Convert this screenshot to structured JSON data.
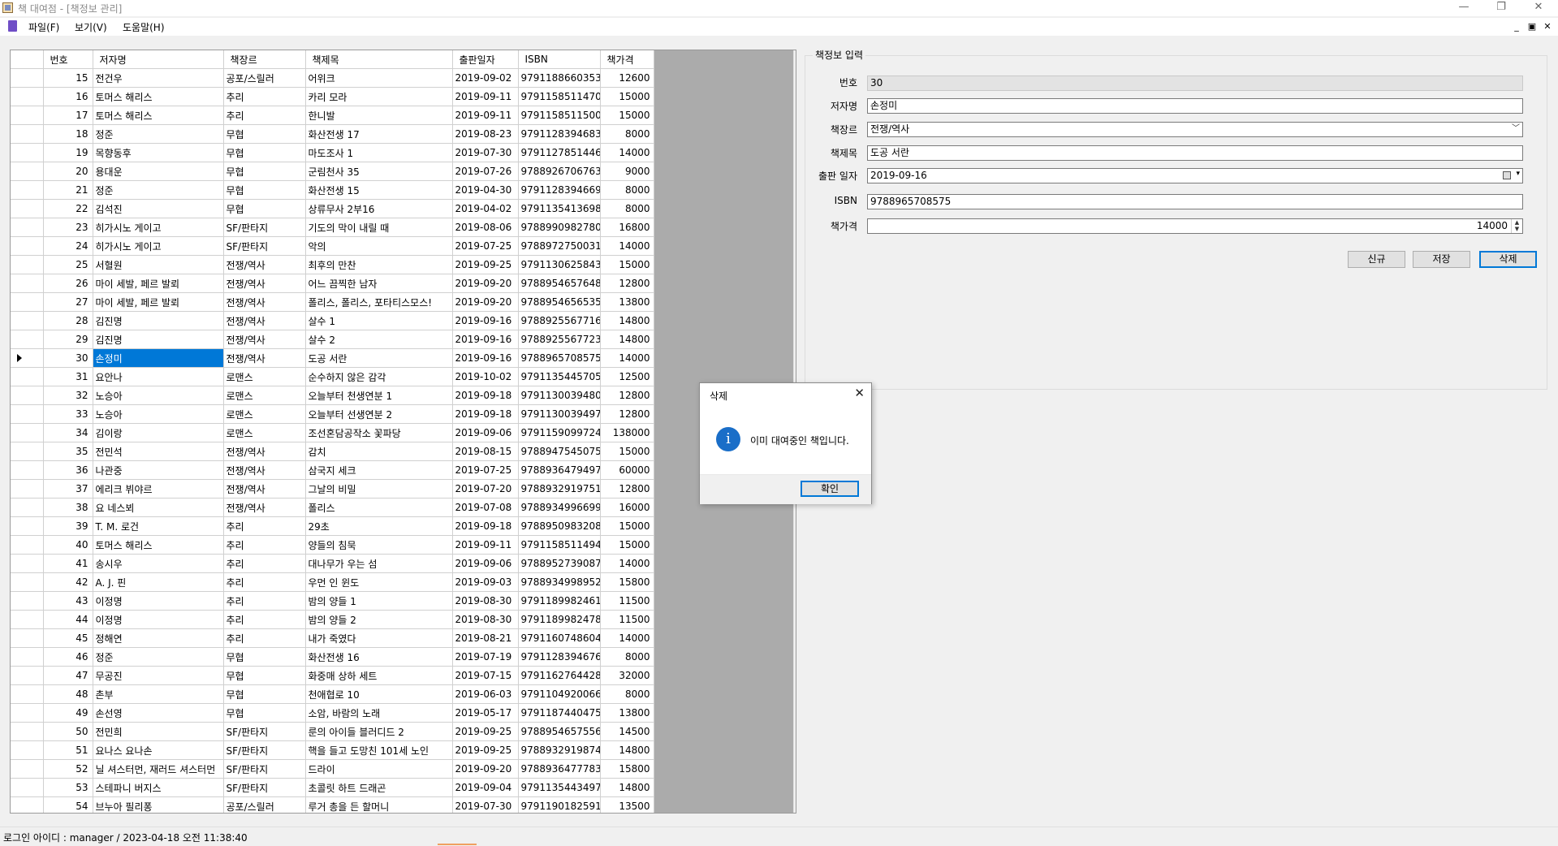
{
  "window": {
    "title": "책 대여점 - [책정보 관리]",
    "minimize": "—",
    "maximize": "❐",
    "close": "✕"
  },
  "menu": {
    "file": "파일(F)",
    "view": "보기(V)",
    "help": "도움말(H)"
  },
  "mdi": {
    "minimize": "_",
    "restore": "▣",
    "close": "✕"
  },
  "grid": {
    "columns": [
      "번호",
      "저자명",
      "책장르",
      "책제목",
      "출판일자",
      "ISBN",
      "책가격"
    ],
    "selected_row": 30,
    "rows": [
      [
        "15",
        "전건우",
        "공포/스릴러",
        "어위크",
        "2019-09-02",
        "9791188660353",
        "12600"
      ],
      [
        "16",
        "토머스 해리스",
        "추리",
        "카리 모라",
        "2019-09-11",
        "9791158511470",
        "15000"
      ],
      [
        "17",
        "토머스 해리스",
        "추리",
        "한니발",
        "2019-09-11",
        "9791158511500",
        "15000"
      ],
      [
        "18",
        "정준",
        "무협",
        "화산전생 17",
        "2019-08-23",
        "9791128394683",
        "8000"
      ],
      [
        "19",
        "목향동후",
        "무협",
        "마도조사 1",
        "2019-07-30",
        "9791127851446",
        "14000"
      ],
      [
        "20",
        "용대운",
        "무협",
        "군림천사 35",
        "2019-07-26",
        "9788926706763",
        "9000"
      ],
      [
        "21",
        "정준",
        "무협",
        "화산전생 15",
        "2019-04-30",
        "9791128394669",
        "8000"
      ],
      [
        "22",
        "김석진",
        "무협",
        "상류무사 2부16",
        "2019-04-02",
        "9791135413698",
        "8000"
      ],
      [
        "23",
        "히가시노 게이고",
        "SF/판타지",
        "기도의 막이 내릴 때",
        "2019-08-06",
        "9788990982780",
        "16800"
      ],
      [
        "24",
        "히가시노 게이고",
        "SF/판타지",
        "악의",
        "2019-07-25",
        "9788972750031",
        "14000"
      ],
      [
        "25",
        "서혈원",
        "전쟁/역사",
        "최후의 만찬",
        "2019-09-25",
        "9791130625843",
        "15000"
      ],
      [
        "26",
        "마이 세발, 페르 발뢰",
        "전쟁/역사",
        "어느 끔찍한 남자",
        "2019-09-20",
        "9788954657648",
        "12800"
      ],
      [
        "27",
        "마이 세발, 페르 발뢰",
        "전쟁/역사",
        "폴리스, 폴리스, 포타티스모스!",
        "2019-09-20",
        "9788954656535",
        "13800"
      ],
      [
        "28",
        "김진명",
        "전쟁/역사",
        "살수 1",
        "2019-09-16",
        "9788925567716",
        "14800"
      ],
      [
        "29",
        "김진명",
        "전쟁/역사",
        "살수 2",
        "2019-09-16",
        "9788925567723",
        "14800"
      ],
      [
        "30",
        "손정미",
        "전쟁/역사",
        "도공 서란",
        "2019-09-16",
        "9788965708575",
        "14000"
      ],
      [
        "31",
        "요안나",
        "로맨스",
        "순수하지 않은 감각",
        "2019-10-02",
        "9791135445705",
        "12500"
      ],
      [
        "32",
        "노승아",
        "로맨스",
        "오늘부터 천생연분 1",
        "2019-09-18",
        "9791130039480",
        "12800"
      ],
      [
        "33",
        "노승아",
        "로맨스",
        "오늘부터 선생연분 2",
        "2019-09-18",
        "9791130039497",
        "12800"
      ],
      [
        "34",
        "김이랑",
        "로맨스",
        "조선혼담공작소 꽃파당",
        "2019-09-06",
        "9791159099724",
        "138000"
      ],
      [
        "35",
        "전민석",
        "전쟁/역사",
        "감치",
        "2019-08-15",
        "9788947545075",
        "15000"
      ],
      [
        "36",
        "나관중",
        "전쟁/역사",
        "삼국지 세크",
        "2019-07-25",
        "9788936479497",
        "60000"
      ],
      [
        "37",
        "에리크 뷔야르",
        "전쟁/역사",
        "그날의 비밀",
        "2019-07-20",
        "9788932919751",
        "12800"
      ],
      [
        "38",
        "요 네스뵈",
        "전쟁/역사",
        "폴리스",
        "2019-07-08",
        "9788934996699",
        "16000"
      ],
      [
        "39",
        "T. M. 로건",
        "추리",
        "29초",
        "2019-09-18",
        "9788950983208",
        "15000"
      ],
      [
        "40",
        "토머스 해리스",
        "추리",
        "양들의 침묵",
        "2019-09-11",
        "9791158511494",
        "15000"
      ],
      [
        "41",
        "송시우",
        "추리",
        "대나무가 우는 섬",
        "2019-09-06",
        "9788952739087",
        "14000"
      ],
      [
        "42",
        "A. J. 핀",
        "추리",
        "우먼 인 윈도",
        "2019-09-03",
        "9788934998952",
        "15800"
      ],
      [
        "43",
        "이정명",
        "추리",
        "밤의 양들 1",
        "2019-08-30",
        "9791189982461",
        "11500"
      ],
      [
        "44",
        "이정명",
        "추리",
        "밤의 양들 2",
        "2019-08-30",
        "9791189982478",
        "11500"
      ],
      [
        "45",
        "정해연",
        "추리",
        "내가 죽였다",
        "2019-08-21",
        "9791160748604",
        "14000"
      ],
      [
        "46",
        "정준",
        "무협",
        "화산전생 16",
        "2019-07-19",
        "9791128394676",
        "8000"
      ],
      [
        "47",
        "무공진",
        "무협",
        "화중매 상하 세트",
        "2019-07-15",
        "9791162764428",
        "32000"
      ],
      [
        "48",
        "촌부",
        "무협",
        "천애협로 10",
        "2019-06-03",
        "9791104920066",
        "8000"
      ],
      [
        "49",
        "손선영",
        "무협",
        "소암, 바람의 노래",
        "2019-05-17",
        "9791187440475",
        "13800"
      ],
      [
        "50",
        "전민희",
        "SF/판타지",
        "룬의 아이들 블러디드 2",
        "2019-09-25",
        "9788954657556",
        "14500"
      ],
      [
        "51",
        "요나스 요나손",
        "SF/판타지",
        "핵을 들고 도망친 101세 노인",
        "2019-09-25",
        "9788932919874",
        "14800"
      ],
      [
        "52",
        "닐 셔스터먼, 재러드 셔스터먼",
        "SF/판타지",
        "드라이",
        "2019-09-20",
        "9788936477783",
        "15800"
      ],
      [
        "53",
        "스테파니 버지스",
        "SF/판타지",
        "초콜릿 하트 드래곤",
        "2019-09-04",
        "9791135443497",
        "14800"
      ],
      [
        "54",
        "브누아 필리퐁",
        "공포/스릴러",
        "루거 총을 든 할머니",
        "2019-07-30",
        "9791190182591",
        "13500"
      ]
    ]
  },
  "form": {
    "group_title": "책정보 입력",
    "labels": {
      "id": "번호",
      "author": "저자명",
      "genre": "책장르",
      "title": "책제목",
      "pub_date": "출판 일자",
      "isbn": "ISBN",
      "price": "책가격"
    },
    "values": {
      "id": "30",
      "author": "손정미",
      "genre": "전쟁/역사",
      "title": "도공 서란",
      "pub_date": "2019-09-16",
      "isbn": "9788965708575",
      "price": "14000"
    },
    "buttons": {
      "new": "신규",
      "save": "저장",
      "delete": "삭제"
    }
  },
  "dialog": {
    "title": "삭제",
    "message": "이미 대여중인 책입니다.",
    "ok": "확인"
  },
  "status": {
    "text": "로그인 아이디 :  manager  / 2023-04-18 오전 11:38:40"
  },
  "colors": {
    "selection": "#0078d7",
    "info_icon": "#1a6ec8"
  }
}
